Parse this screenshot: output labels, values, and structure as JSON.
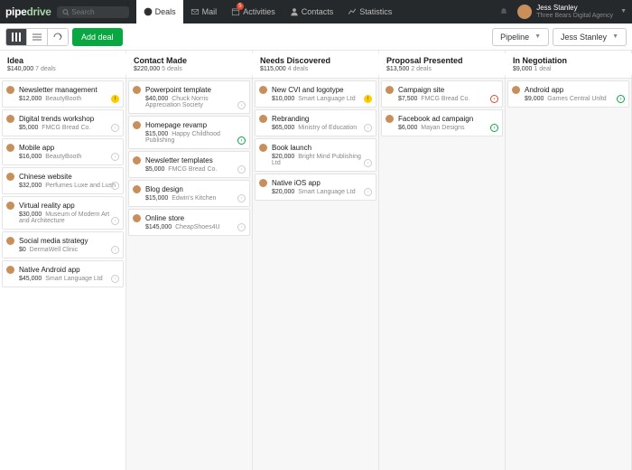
{
  "brand": {
    "p1": "pipe",
    "p2": "drive"
  },
  "search": {
    "placeholder": "Search"
  },
  "nav": [
    {
      "label": "Deals",
      "icon": "dollar-icon",
      "active": true
    },
    {
      "label": "Mail",
      "icon": "mail-icon"
    },
    {
      "label": "Activities",
      "icon": "calendar-icon",
      "badge": "5"
    },
    {
      "label": "Contacts",
      "icon": "person-icon"
    },
    {
      "label": "Statistics",
      "icon": "stats-icon"
    }
  ],
  "user": {
    "name": "Jess Stanley",
    "org": "Three Bears Digital Agency"
  },
  "toolbar": {
    "add_deal": "Add deal",
    "pipeline_label": "Pipeline",
    "user_filter": "Jess Stanley"
  },
  "columns": [
    {
      "title": "Idea",
      "amount": "$140,000",
      "count": "7 deals",
      "cards": [
        {
          "title": "Newsletter management",
          "amount": "$12,000",
          "org": "BeautyBooth",
          "status": "yellow"
        },
        {
          "title": "Digital trends workshop",
          "amount": "$5,000",
          "org": "FMCG Bread Co.",
          "status": "gray"
        },
        {
          "title": "Mobile app",
          "amount": "$16,000",
          "org": "BeautyBooth",
          "status": "gray"
        },
        {
          "title": "Chinese website",
          "amount": "$32,000",
          "org": "Perfumes Luxe and Lush",
          "status": "gray"
        },
        {
          "title": "Virtual reality app",
          "amount": "$30,000",
          "org": "Museum of Modern Art and Architecture",
          "status": "gray"
        },
        {
          "title": "Social media strategy",
          "amount": "$0",
          "org": "DermaWell Clinic",
          "status": "gray"
        },
        {
          "title": "Native Android app",
          "amount": "$45,000",
          "org": "Smart Language Ltd",
          "status": "gray"
        }
      ]
    },
    {
      "title": "Contact Made",
      "amount": "$220,000",
      "count": "5 deals",
      "cards": [
        {
          "title": "Powerpoint template",
          "amount": "$40,000",
          "org": "Chuck Norris Appreciation Society",
          "status": "gray"
        },
        {
          "title": "Homepage revamp",
          "amount": "$15,000",
          "org": "Happy Childhood Publishing",
          "status": "green"
        },
        {
          "title": "Newsletter templates",
          "amount": "$5,000",
          "org": "FMCG Bread Co.",
          "status": "gray"
        },
        {
          "title": "Blog design",
          "amount": "$15,000",
          "org": "Edwin's Kitchen",
          "status": "gray"
        },
        {
          "title": "Online store",
          "amount": "$145,000",
          "org": "CheapShoes4U",
          "status": "gray"
        }
      ]
    },
    {
      "title": "Needs Discovered",
      "amount": "$115,000",
      "count": "4 deals",
      "cards": [
        {
          "title": "New CVI and logotype",
          "amount": "$10,000",
          "org": "Smart Language Ltd",
          "status": "yellow"
        },
        {
          "title": "Rebranding",
          "amount": "$65,000",
          "org": "Ministry of Education",
          "status": "gray"
        },
        {
          "title": "Book launch",
          "amount": "$20,000",
          "org": "Bright Mind Publishing Ltd",
          "status": "gray"
        },
        {
          "title": "Native iOS app",
          "amount": "$20,000",
          "org": "Smart Language Ltd",
          "status": "gray"
        }
      ]
    },
    {
      "title": "Proposal Presented",
      "amount": "$13,500",
      "count": "2 deals",
      "cards": [
        {
          "title": "Campaign site",
          "amount": "$7,500",
          "org": "FMCG Bread Co.",
          "status": "red"
        },
        {
          "title": "Facebook ad campaign",
          "amount": "$6,000",
          "org": "Mayan Designs",
          "status": "green"
        }
      ]
    },
    {
      "title": "In Negotiation",
      "amount": "$9,000",
      "count": "1 deal",
      "cards": [
        {
          "title": "Android app",
          "amount": "$9,000",
          "org": "Games Central Unltd",
          "status": "green"
        }
      ]
    }
  ]
}
